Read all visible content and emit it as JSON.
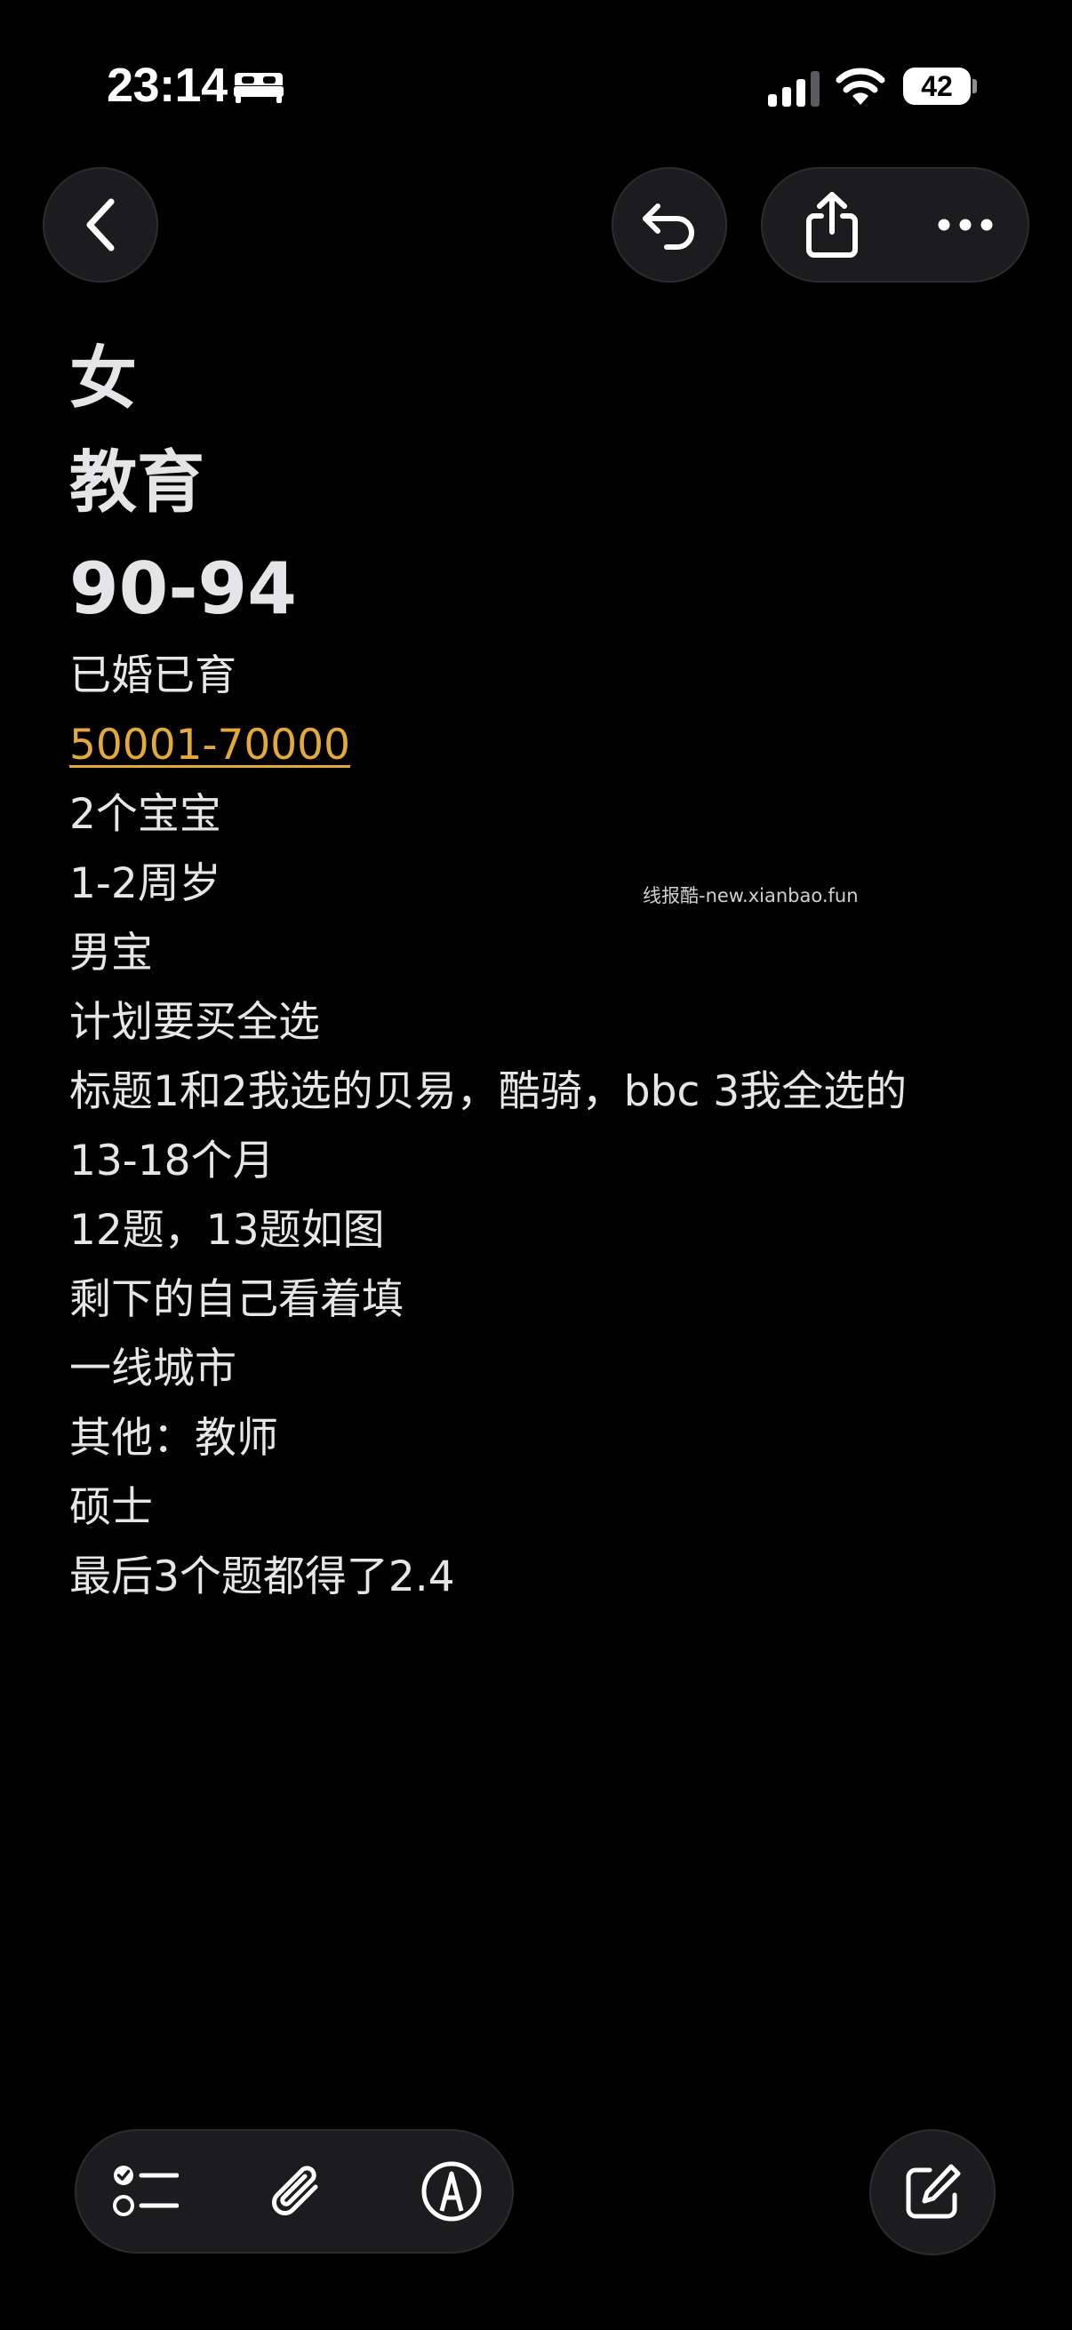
{
  "status_bar": {
    "time": "23:14",
    "battery_level": "42",
    "icons": [
      "bed-icon",
      "cellular-signal-icon",
      "wifi-icon",
      "battery-icon"
    ]
  },
  "nav": {
    "icons": [
      "chevron-left-icon",
      "undo-icon",
      "share-icon",
      "ellipsis-icon"
    ]
  },
  "note": {
    "headings": [
      "女",
      "教育",
      "90-94"
    ],
    "lines": [
      "已婚已育",
      "50001-70000",
      "2个宝宝",
      "1-2周岁",
      "男宝",
      "计划要买全选",
      "标题1和2我选的贝易，酷骑，bbc   3我全选的",
      "13-18个月",
      "12题，13题如图",
      "剩下的自己看着填",
      "一线城市",
      "其他：教师",
      "硕士",
      "最后3个题都得了2.4"
    ],
    "link_color": "#e3a93b"
  },
  "watermark": "线报酷-new.xianbao.fun",
  "toolbar": {
    "icons": [
      "checklist-icon",
      "paperclip-icon",
      "markup-pen-icon",
      "compose-icon"
    ]
  },
  "colors": {
    "background": "#000000",
    "button_bg": "#1c1c1e",
    "text": "#e6e6e8"
  }
}
